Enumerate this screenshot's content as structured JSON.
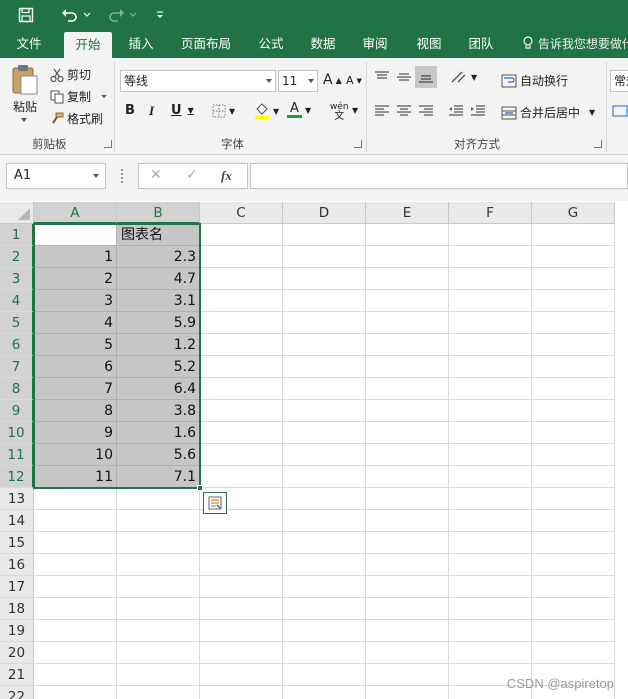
{
  "quick_access": {
    "save_icon": "save-icon",
    "undo_icon": "undo-icon",
    "redo_icon": "redo-icon",
    "customize_icon": "customize-qat-icon"
  },
  "tabs": [
    {
      "label": "文件",
      "active": false
    },
    {
      "label": "开始",
      "active": true
    },
    {
      "label": "插入",
      "active": false
    },
    {
      "label": "页面布局",
      "active": false
    },
    {
      "label": "公式",
      "active": false
    },
    {
      "label": "数据",
      "active": false
    },
    {
      "label": "审阅",
      "active": false
    },
    {
      "label": "视图",
      "active": false
    },
    {
      "label": "团队",
      "active": false
    }
  ],
  "tell_me": "告诉我您想要做什",
  "clipboard": {
    "paste": "粘贴",
    "cut": "剪切",
    "copy": "复制",
    "format_painter": "格式刷",
    "group_label": "剪贴板"
  },
  "font": {
    "font_name": "等线",
    "font_size": "11",
    "grow": "A",
    "shrink": "A",
    "bold": "B",
    "italic": "I",
    "underline": "U",
    "font_color_letter": "A",
    "phonetic": "wén",
    "group_label": "字体"
  },
  "alignment": {
    "wrap_text": "自动换行",
    "merge_center": "合并后居中",
    "group_label": "对齐方式"
  },
  "number": {
    "format": "常规"
  },
  "formula_bar": {
    "name_box": "A1",
    "cancel": "✕",
    "enter": "✓",
    "fx": "fx",
    "formula": ""
  },
  "sheet": {
    "columns": [
      "A",
      "B",
      "C",
      "D",
      "E",
      "F",
      "G"
    ],
    "rows": [
      "1",
      "2",
      "3",
      "4",
      "5",
      "6",
      "7",
      "8",
      "9",
      "10",
      "11",
      "12",
      "13",
      "14",
      "15",
      "16",
      "17",
      "18",
      "19",
      "20",
      "21",
      "22"
    ],
    "header_b": "图表名",
    "col_a": [
      "",
      "1",
      "2",
      "3",
      "4",
      "5",
      "6",
      "7",
      "8",
      "9",
      "10",
      "11"
    ],
    "col_b": [
      "图表名",
      "2.3",
      "4.7",
      "3.1",
      "5.9",
      "1.2",
      "5.2",
      "6.4",
      "3.8",
      "1.6",
      "5.6",
      "7.1"
    ]
  },
  "colors": {
    "accent": "#217346",
    "selection": "#c6c6c6"
  },
  "watermark": "CSDN @aspiretop"
}
